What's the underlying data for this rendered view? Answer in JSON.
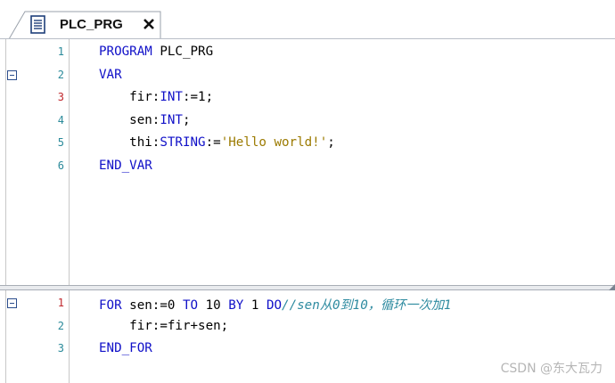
{
  "tab": {
    "title": "PLC_PRG",
    "icon": "document-icon",
    "close_icon": "close-icon"
  },
  "declaration_editor": {
    "lines": [
      {
        "number": "1",
        "fold": false,
        "tokens": [
          {
            "t": "PROGRAM",
            "c": "kw"
          },
          {
            "t": " PLC_PRG",
            "c": ""
          }
        ]
      },
      {
        "number": "2",
        "fold": true,
        "tokens": [
          {
            "t": "VAR",
            "c": "kw"
          }
        ]
      },
      {
        "number": "3",
        "fold": false,
        "red": true,
        "tokens": [
          {
            "t": "    fir:",
            "c": ""
          },
          {
            "t": "INT",
            "c": "kw"
          },
          {
            "t": ":=1;",
            "c": ""
          }
        ]
      },
      {
        "number": "4",
        "fold": false,
        "tokens": [
          {
            "t": "    sen:",
            "c": ""
          },
          {
            "t": "INT",
            "c": "kw"
          },
          {
            "t": ";",
            "c": ""
          }
        ]
      },
      {
        "number": "5",
        "fold": false,
        "tokens": [
          {
            "t": "    thi:",
            "c": ""
          },
          {
            "t": "STRING",
            "c": "kw"
          },
          {
            "t": ":=",
            "c": ""
          },
          {
            "t": "'Hello world!'",
            "c": "str"
          },
          {
            "t": ";",
            "c": ""
          }
        ]
      },
      {
        "number": "6",
        "fold": false,
        "tokens": [
          {
            "t": "END_VAR",
            "c": "kw"
          }
        ]
      }
    ]
  },
  "implementation_editor": {
    "lines": [
      {
        "number": "1",
        "fold": true,
        "red": true,
        "tokens": [
          {
            "t": "FOR",
            "c": "kw"
          },
          {
            "t": " sen:=0 ",
            "c": ""
          },
          {
            "t": "TO",
            "c": "kw"
          },
          {
            "t": " 10 ",
            "c": ""
          },
          {
            "t": "BY",
            "c": "kw"
          },
          {
            "t": " 1 ",
            "c": ""
          },
          {
            "t": "DO",
            "c": "kw"
          },
          {
            "t": "//sen从0到10，循环一次加1",
            "c": "cmt"
          }
        ]
      },
      {
        "number": "2",
        "fold": false,
        "tokens": [
          {
            "t": "    fir:=fir+sen;",
            "c": ""
          }
        ]
      },
      {
        "number": "3",
        "fold": false,
        "tokens": [
          {
            "t": "END_FOR",
            "c": "kw"
          }
        ]
      }
    ]
  },
  "watermark": "CSDN @东大瓦力",
  "colors": {
    "keyword": "#1010c8",
    "string": "#9b7a00",
    "comment": "#2e8ba0",
    "line_number": "#2b8a9a",
    "line_number_modified": "#c0282d"
  }
}
